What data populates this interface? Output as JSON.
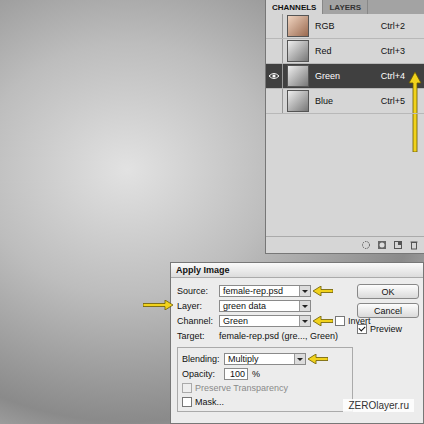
{
  "channels_panel": {
    "tabs": [
      {
        "label": "CHANNELS",
        "selected": true
      },
      {
        "label": "LAYERS",
        "selected": false
      }
    ],
    "channels": [
      {
        "name": "RGB",
        "shortcut": "Ctrl+2",
        "kind": "composite",
        "visible": false,
        "selected": false,
        "annotated": false
      },
      {
        "name": "Red",
        "shortcut": "Ctrl+3",
        "kind": "channel",
        "visible": false,
        "selected": false,
        "annotated": false
      },
      {
        "name": "Green",
        "shortcut": "Ctrl+4",
        "kind": "channel",
        "visible": true,
        "selected": true,
        "annotated": true
      },
      {
        "name": "Blue",
        "shortcut": "Ctrl+5",
        "kind": "channel",
        "visible": false,
        "selected": false,
        "annotated": false
      }
    ]
  },
  "dialog": {
    "title": "Apply Image",
    "source": {
      "label": "Source:",
      "value": "female-rep.psd",
      "arrow_side": "right"
    },
    "layer": {
      "label": "Layer:",
      "value": "green data",
      "arrow_side": "left"
    },
    "channel": {
      "label": "Channel:",
      "value": "Green",
      "arrow_side": "right"
    },
    "invert": {
      "label": "Invert",
      "checked": false
    },
    "target": {
      "label": "Target:",
      "value": "female-rep.psd (gre..., Green)"
    },
    "blending": {
      "label": "Blending:",
      "value": "Multiply",
      "arrow_side": "right"
    },
    "opacity": {
      "label": "Opacity:",
      "value": "100",
      "unit": "%"
    },
    "preserve_transparency": {
      "label": "Preserve Transparency",
      "checked": false,
      "disabled": true
    },
    "mask": {
      "label": "Mask...",
      "checked": false
    },
    "buttons": [
      "OK",
      "Cancel"
    ],
    "preview": {
      "label": "Preview",
      "checked": true
    }
  },
  "watermark": "ZEROlayer.ru"
}
